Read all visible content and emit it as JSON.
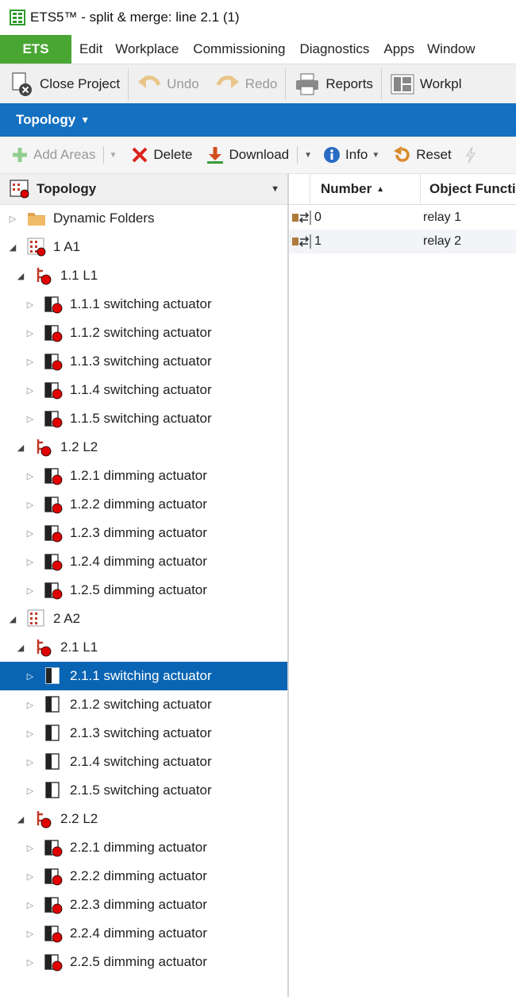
{
  "window": {
    "title": "ETS5™ - split & merge: line 2.1 (1)"
  },
  "menu": {
    "ets": "ETS",
    "items": [
      "Edit",
      "Workplace",
      "Commissioning",
      "Diagnostics",
      "Apps",
      "Window"
    ]
  },
  "toolbar": {
    "close_project": "Close Project",
    "undo": "Undo",
    "redo": "Redo",
    "reports": "Reports",
    "workplace": "Workpl"
  },
  "panel": {
    "title": "Topology"
  },
  "actions": {
    "add_areas": "Add Areas",
    "delete": "Delete",
    "download": "Download",
    "info": "Info",
    "reset": "Reset"
  },
  "tree": {
    "header": "Topology",
    "items": [
      {
        "label": "Dynamic Folders",
        "level": 0,
        "icon": "folder",
        "expanded": false
      },
      {
        "label": "1 A1",
        "level": 0,
        "icon": "area",
        "expanded": true
      },
      {
        "label": "1.1 L1",
        "level": 1,
        "icon": "line",
        "expanded": true
      },
      {
        "label": "1.1.1 switching actuator",
        "level": 2,
        "icon": "device-error",
        "expanded": false
      },
      {
        "label": "1.1.2 switching actuator",
        "level": 2,
        "icon": "device-error",
        "expanded": false
      },
      {
        "label": "1.1.3 switching actuator",
        "level": 2,
        "icon": "device-error",
        "expanded": false
      },
      {
        "label": "1.1.4 switching actuator",
        "level": 2,
        "icon": "device-error",
        "expanded": false
      },
      {
        "label": "1.1.5 switching actuator",
        "level": 2,
        "icon": "device-error",
        "expanded": false
      },
      {
        "label": "1.2 L2",
        "level": 1,
        "icon": "line",
        "expanded": true
      },
      {
        "label": "1.2.1 dimming actuator",
        "level": 2,
        "icon": "device-error",
        "expanded": false
      },
      {
        "label": "1.2.2 dimming actuator",
        "level": 2,
        "icon": "device-error",
        "expanded": false
      },
      {
        "label": "1.2.3 dimming actuator",
        "level": 2,
        "icon": "device-error",
        "expanded": false
      },
      {
        "label": "1.2.4 dimming actuator",
        "level": 2,
        "icon": "device-error",
        "expanded": false
      },
      {
        "label": "1.2.5 dimming actuator",
        "level": 2,
        "icon": "device-error",
        "expanded": false
      },
      {
        "label": "2 A2",
        "level": 0,
        "icon": "area-plain",
        "expanded": true
      },
      {
        "label": "2.1 L1",
        "level": 1,
        "icon": "line",
        "expanded": true
      },
      {
        "label": "2.1.1 switching actuator",
        "level": 2,
        "icon": "device",
        "expanded": false,
        "selected": true
      },
      {
        "label": "2.1.2 switching actuator",
        "level": 2,
        "icon": "device",
        "expanded": false
      },
      {
        "label": "2.1.3 switching actuator",
        "level": 2,
        "icon": "device",
        "expanded": false
      },
      {
        "label": "2.1.4 switching actuator",
        "level": 2,
        "icon": "device",
        "expanded": false
      },
      {
        "label": "2.1.5 switching actuator",
        "level": 2,
        "icon": "device",
        "expanded": false
      },
      {
        "label": "2.2 L2",
        "level": 1,
        "icon": "line",
        "expanded": true
      },
      {
        "label": "2.2.1 dimming actuator",
        "level": 2,
        "icon": "device-error",
        "expanded": false
      },
      {
        "label": "2.2.2 dimming actuator",
        "level": 2,
        "icon": "device-error",
        "expanded": false
      },
      {
        "label": "2.2.3 dimming actuator",
        "level": 2,
        "icon": "device-error",
        "expanded": false
      },
      {
        "label": "2.2.4 dimming actuator",
        "level": 2,
        "icon": "device-error",
        "expanded": false
      },
      {
        "label": "2.2.5 dimming actuator",
        "level": 2,
        "icon": "device-error",
        "expanded": false
      }
    ]
  },
  "grid": {
    "columns": [
      "Number",
      "Object Functi"
    ],
    "sort_indicator": "▲",
    "rows": [
      {
        "number": "0",
        "function": "relay 1"
      },
      {
        "number": "1",
        "function": "relay 2"
      }
    ]
  },
  "colors": {
    "accent_blue": "#1470c0",
    "ets_green": "#4aa633",
    "selection": "#0a64b4",
    "error_red": "#e00000"
  }
}
